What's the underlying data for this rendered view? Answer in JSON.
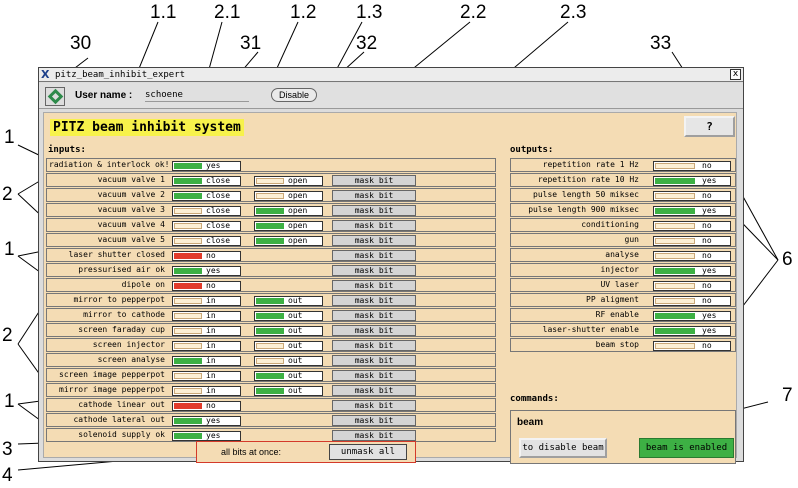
{
  "callouts": {
    "n30": "30",
    "n31": "31",
    "n32": "32",
    "n33": "33",
    "n11": "1.1",
    "n21": "2.1",
    "n12": "1.2",
    "n13": "1.3",
    "n22": "2.2",
    "n23": "2.3",
    "l1a": "1",
    "l2a": "2",
    "l1b": "1",
    "l2b": "2",
    "l1c": "1",
    "l3": "3",
    "l4": "4",
    "r6": "6",
    "r7": "7"
  },
  "window": {
    "title": "pitz_beam_inhibit_expert",
    "close_glyph": "x",
    "logo_glyph": "X"
  },
  "toolbar": {
    "user_label": "User name :",
    "user_value": "schoene",
    "disable_label": "Disable"
  },
  "panel": {
    "title": "PITZ beam inhibit system",
    "help_label": "?",
    "inputs_label": "inputs:",
    "outputs_label": "outputs:",
    "commands_label": "commands:"
  },
  "inputs": [
    {
      "label": "radiation & interlock ok!",
      "s1": "on",
      "t1": "yes"
    },
    {
      "label": "vacuum valve 1",
      "s1": "on",
      "t1": "close",
      "s2": "off",
      "t2": "open",
      "mask": "mask bit"
    },
    {
      "label": "vacuum valve 2",
      "s1": "on",
      "t1": "close",
      "s2": "off",
      "t2": "open",
      "mask": "mask bit"
    },
    {
      "label": "vacuum valve 3",
      "s1": "off",
      "t1": "close",
      "s2": "on",
      "t2": "open",
      "mask": "mask bit"
    },
    {
      "label": "vacuum valve 4",
      "s1": "off",
      "t1": "close",
      "s2": "on",
      "t2": "open",
      "mask": "mask bit"
    },
    {
      "label": "vacuum valve 5",
      "s1": "off",
      "t1": "close",
      "s2": "on",
      "t2": "open",
      "mask": "mask bit"
    },
    {
      "label": "laser shutter closed",
      "s1": "red",
      "t1": "no",
      "mask": "mask bit"
    },
    {
      "label": "pressurised air ok",
      "s1": "on",
      "t1": "yes",
      "mask": "mask bit"
    },
    {
      "label": "dipole on",
      "s1": "red",
      "t1": "no",
      "mask": "mask bit"
    },
    {
      "label": "mirror to pepperpot",
      "s1": "off",
      "t1": "in",
      "s2": "on",
      "t2": "out",
      "mask": "mask bit"
    },
    {
      "label": "mirror to cathode",
      "s1": "off",
      "t1": "in",
      "s2": "on",
      "t2": "out",
      "mask": "mask bit"
    },
    {
      "label": "screen faraday cup",
      "s1": "off",
      "t1": "in",
      "s2": "on",
      "t2": "out",
      "mask": "mask bit"
    },
    {
      "label": "screen injector",
      "s1": "off",
      "t1": "in",
      "s2": "off",
      "t2": "out",
      "mask": "mask bit"
    },
    {
      "label": "screen analyse",
      "s1": "on",
      "t1": "in",
      "s2": "off",
      "t2": "out",
      "mask": "mask bit"
    },
    {
      "label": "screen image pepperpot",
      "s1": "off",
      "t1": "in",
      "s2": "on",
      "t2": "out",
      "mask": "mask bit"
    },
    {
      "label": "mirror image pepperpot",
      "s1": "off",
      "t1": "in",
      "s2": "on",
      "t2": "out",
      "mask": "mask bit"
    },
    {
      "label": "cathode linear out",
      "s1": "red",
      "t1": "no",
      "mask": "mask bit"
    },
    {
      "label": "cathode lateral out",
      "s1": "on",
      "t1": "yes",
      "mask": "mask bit"
    },
    {
      "label": "solenoid supply ok",
      "s1": "on",
      "t1": "yes",
      "mask": "mask bit"
    }
  ],
  "all_bits": {
    "label": "all bits at once:",
    "button": "unmask all"
  },
  "outputs": [
    {
      "label": "repetition rate 1 Hz",
      "s": "off",
      "t": "no"
    },
    {
      "label": "repetition rate 10 Hz",
      "s": "on",
      "t": "yes"
    },
    {
      "label": "pulse length 50 miksec",
      "s": "off",
      "t": "no"
    },
    {
      "label": "pulse length 900 miksec",
      "s": "on",
      "t": "yes"
    },
    {
      "label": "conditioning",
      "s": "off",
      "t": "no"
    },
    {
      "label": "gun",
      "s": "off",
      "t": "no"
    },
    {
      "label": "analyse",
      "s": "off",
      "t": "no"
    },
    {
      "label": "injector",
      "s": "on",
      "t": "yes"
    },
    {
      "label": "UV laser",
      "s": "off",
      "t": "no"
    },
    {
      "label": "PP aligment",
      "s": "off",
      "t": "no"
    },
    {
      "label": "RF enable",
      "s": "on",
      "t": "yes"
    },
    {
      "label": "laser-shutter enable",
      "s": "on",
      "t": "yes"
    },
    {
      "label": "beam stop",
      "s": "off",
      "t": "no"
    }
  ],
  "commands": {
    "name": "beam",
    "disable_button": "to disable beam",
    "status": "beam is enabled"
  },
  "colors": {
    "on": "#3db044",
    "off": "#fcefd4",
    "red": "#e13b2b",
    "panel": "#f4dcb4",
    "title_highlight": "#f7f24b"
  }
}
